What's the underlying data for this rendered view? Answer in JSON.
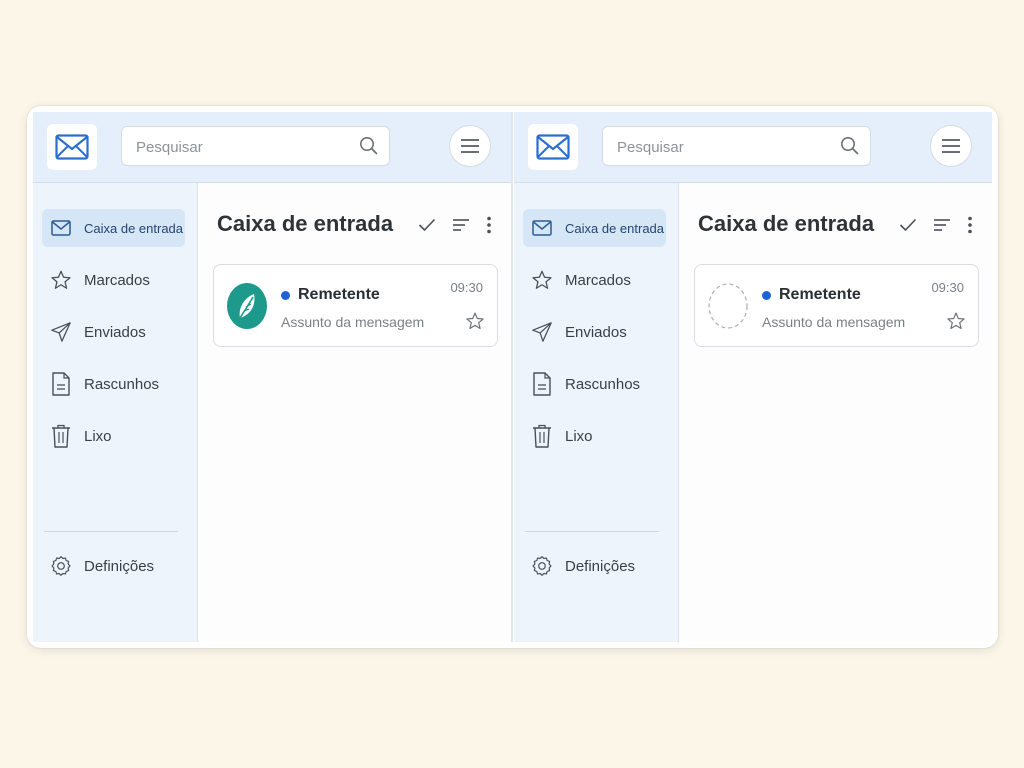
{
  "panes": [
    {
      "search": {
        "placeholder": "Pesquisar"
      },
      "nav": [
        {
          "label": "Caixa de entrada",
          "icon": "mail-icon",
          "active": true
        },
        {
          "label": "Marcados",
          "icon": "star-icon"
        },
        {
          "label": "Enviados",
          "icon": "send-icon"
        },
        {
          "label": "Rascunhos",
          "icon": "draft-icon"
        },
        {
          "label": "Lixo",
          "icon": "trash-icon"
        }
      ],
      "settings": {
        "label": "Definições",
        "icon": "gear-icon"
      },
      "main": {
        "title": "Caixa de entrada"
      },
      "message": {
        "sender": "Remetente",
        "subject": "Assunto da mensagem",
        "time": "09:30",
        "avatar": "leaf-avatar",
        "avatar_color": "#1e9a8c"
      }
    },
    {
      "search": {
        "placeholder": "Pesquisar"
      },
      "nav": [
        {
          "label": "Caixa de entrada",
          "icon": "mail-icon",
          "active": true
        },
        {
          "label": "Marcados",
          "icon": "star-icon"
        },
        {
          "label": "Enviados",
          "icon": "send-icon"
        },
        {
          "label": "Rascunhos",
          "icon": "draft-icon"
        },
        {
          "label": "Lixo",
          "icon": "trash-icon"
        }
      ],
      "settings": {
        "label": "Definições",
        "icon": "gear-icon"
      },
      "main": {
        "title": "Caixa de entrada"
      },
      "message": {
        "sender": "Remetente",
        "subject": "Assunto da mensagem",
        "time": "09:30",
        "avatar": "empty-avatar-placeholder"
      }
    }
  ],
  "colors": {
    "accent": "#1e63d6",
    "header_bg": "#e4effb",
    "sidebar_bg": "#edf4fc",
    "active_bg": "#d5e6f7",
    "page_bg": "#fbf6e8"
  }
}
